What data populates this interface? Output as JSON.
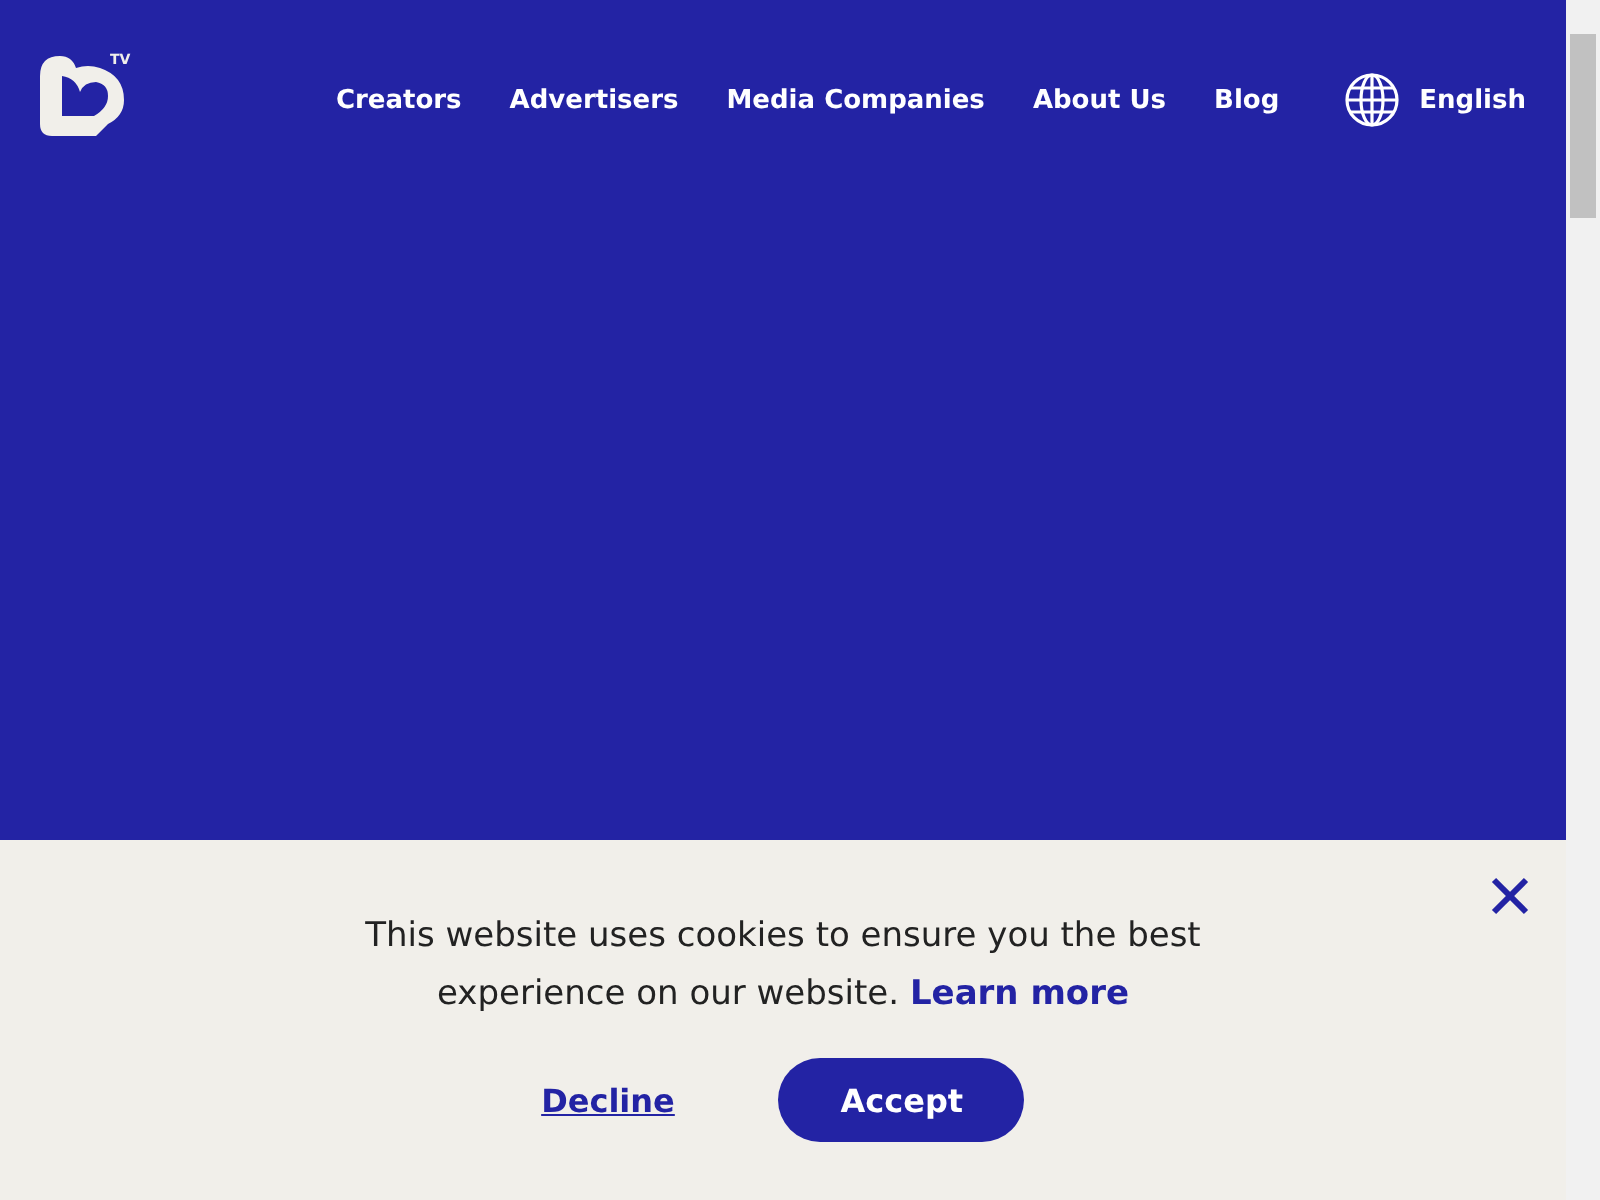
{
  "logo": {
    "badge": "TV"
  },
  "nav": [
    {
      "label": "Creators"
    },
    {
      "label": "Advertisers"
    },
    {
      "label": "Media Companies"
    },
    {
      "label": "About Us"
    },
    {
      "label": "Blog"
    }
  ],
  "language": {
    "label": "English"
  },
  "cookie_banner": {
    "message": "This website uses cookies to ensure you the best experience on our website.",
    "link": "Learn more",
    "buttons": [
      {
        "label": "Decline",
        "kind": "link"
      },
      {
        "label": "Accept",
        "kind": "primary"
      }
    ]
  }
}
